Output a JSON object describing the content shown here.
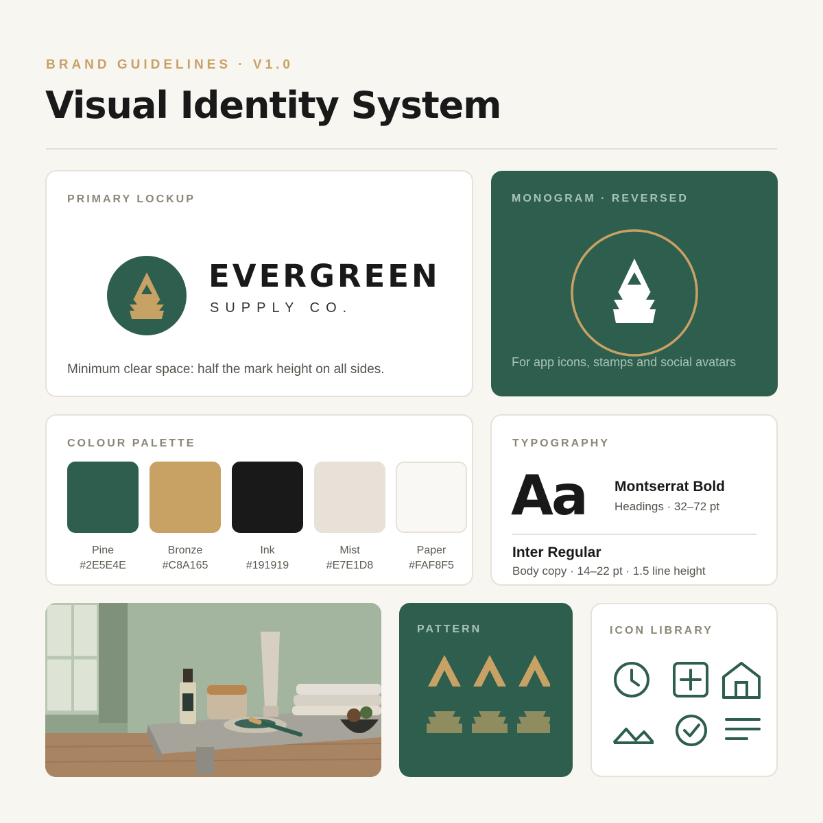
{
  "header": {
    "eyebrow": "BRAND GUIDELINES · V1.0",
    "title": "Visual Identity System"
  },
  "lockup": {
    "label": "PRIMARY LOCKUP",
    "wordmark": "EVERGREEN",
    "wordmark_sub": "SUPPLY CO.",
    "note": "Minimum clear space: half the mark height on all sides."
  },
  "monogram": {
    "label": "MONOGRAM · REVERSED",
    "note": "For app icons, stamps and social avatars"
  },
  "palette": {
    "label": "COLOUR PALETTE",
    "swatches": [
      {
        "name": "Pine",
        "hex": "#2E5E4E"
      },
      {
        "name": "Bronze",
        "hex": "#C8A165"
      },
      {
        "name": "Ink",
        "hex": "#191919"
      },
      {
        "name": "Mist",
        "hex": "#E7E1D8"
      },
      {
        "name": "Paper",
        "hex": "#FAF8F5"
      }
    ]
  },
  "typography": {
    "label": "TYPOGRAPHY",
    "specimen": "Aa",
    "heading_font": "Montserrat Bold",
    "heading_use": "Headings · 32–72 pt",
    "body_font": "Inter Regular",
    "body_use": "Body copy · 14–22 pt · 1.5 line height"
  },
  "pattern": {
    "label": "PATTERN"
  },
  "icon_library": {
    "label": "ICON LIBRARY",
    "icons": [
      "clock-icon",
      "plus-square-icon",
      "home-icon",
      "mountain-icon",
      "check-circle-icon",
      "menu-lines-icon"
    ]
  },
  "colors": {
    "pine": "#2E5E4E",
    "bronze": "#C8A165",
    "ink": "#191919",
    "mist": "#E7E1D8",
    "paper": "#FAF8F5",
    "olive": "#8F8D60"
  }
}
